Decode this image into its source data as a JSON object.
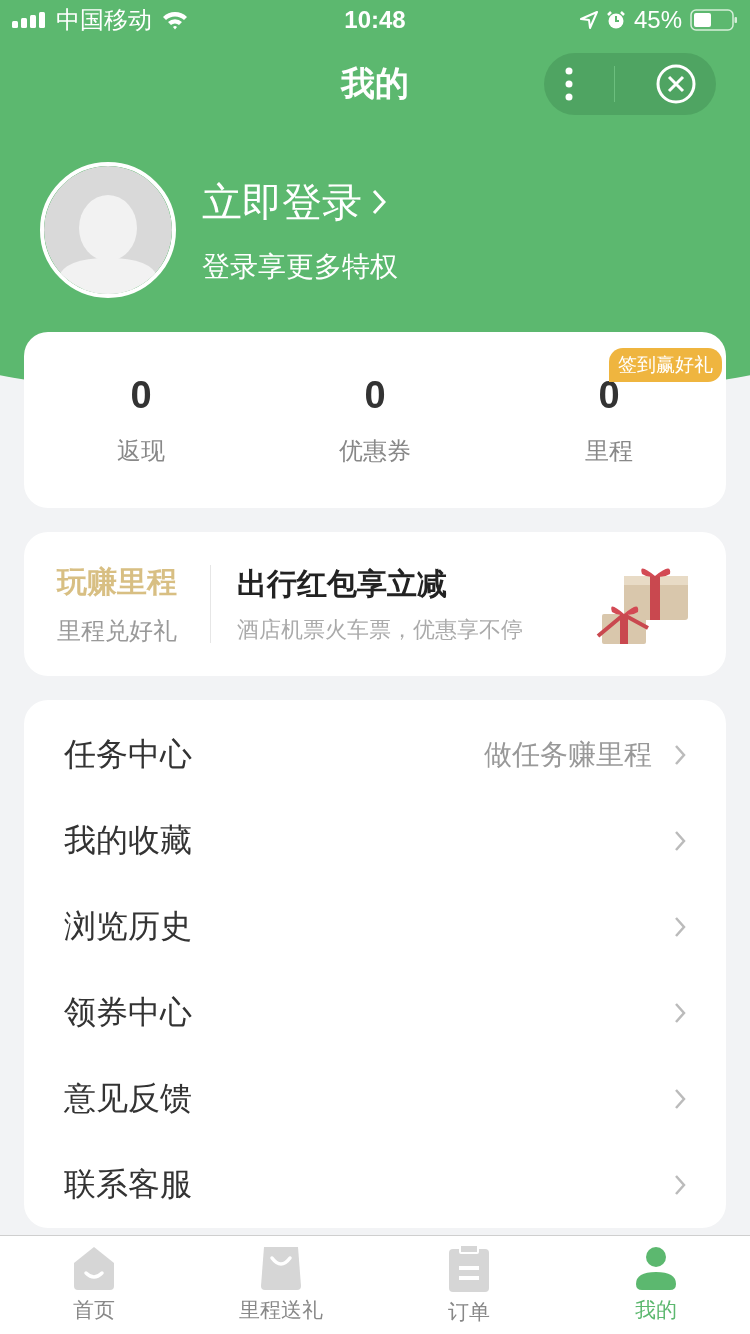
{
  "status_bar": {
    "carrier": "中国移动",
    "time": "10:48",
    "battery": "45%"
  },
  "nav": {
    "title": "我的"
  },
  "profile": {
    "login": "立即登录",
    "subtitle": "登录享更多特权"
  },
  "stats": {
    "badge": "签到赢好礼",
    "items": [
      {
        "value": "0",
        "label": "返现"
      },
      {
        "value": "0",
        "label": "优惠券"
      },
      {
        "value": "0",
        "label": "里程"
      }
    ]
  },
  "promo": {
    "title": "玩赚里程",
    "subtitle": "里程兑好礼",
    "headline": "出行红包享立减",
    "description": "酒店机票火车票，优惠享不停"
  },
  "menu": [
    {
      "label": "任务中心",
      "hint": "做任务赚里程"
    },
    {
      "label": "我的收藏"
    },
    {
      "label": "浏览历史"
    },
    {
      "label": "领券中心"
    },
    {
      "label": "意见反馈"
    },
    {
      "label": "联系客服"
    }
  ],
  "tab_bar": [
    {
      "kind": "home",
      "label": "首页",
      "selected": false
    },
    {
      "kind": "bag",
      "label": "里程送礼",
      "selected": false
    },
    {
      "kind": "orders",
      "label": "订单",
      "selected": false
    },
    {
      "kind": "me",
      "label": "我的",
      "selected": true
    }
  ]
}
